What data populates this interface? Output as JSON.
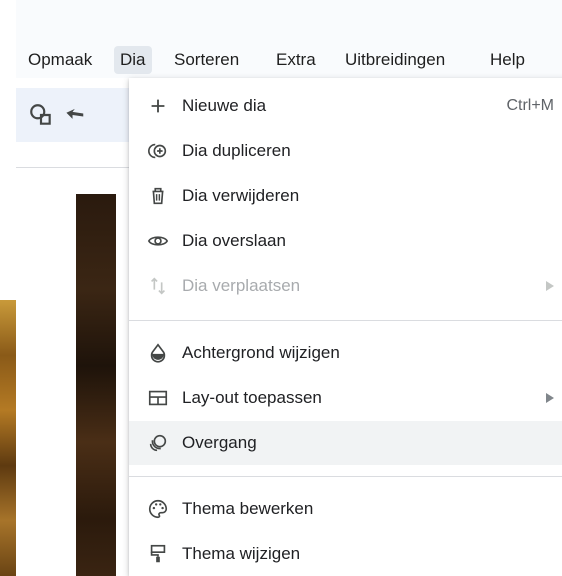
{
  "menubar": {
    "items": [
      {
        "label": "Opmaak"
      },
      {
        "label": "Dia"
      },
      {
        "label": "Sorteren"
      },
      {
        "label": "Extra"
      },
      {
        "label": "Uitbreidingen"
      },
      {
        "label": "Help"
      }
    ],
    "active": "Dia"
  },
  "toolbar": {
    "icons": [
      "shapes-icon",
      "select-arrow-icon"
    ]
  },
  "dia_menu": {
    "items": [
      {
        "label": "Nieuwe dia",
        "icon": "plus-icon",
        "shortcut": "Ctrl+M"
      },
      {
        "label": "Dia dupliceren",
        "icon": "duplicate-icon"
      },
      {
        "label": "Dia verwijderen",
        "icon": "trash-icon"
      },
      {
        "label": "Dia overslaan",
        "icon": "eye-icon"
      },
      {
        "label": "Dia verplaatsen",
        "icon": "move-icon",
        "disabled": true,
        "submenu": true
      },
      {
        "label": "Achtergrond wijzigen",
        "icon": "fill-drop-icon"
      },
      {
        "label": "Lay-out toepassen",
        "icon": "layout-icon",
        "submenu": true
      },
      {
        "label": "Overgang",
        "icon": "transition-icon",
        "hovered": true
      },
      {
        "label": "Thema bewerken",
        "icon": "palette-icon"
      },
      {
        "label": "Thema wijzigen",
        "icon": "paint-roller-icon"
      }
    ]
  },
  "colors": {
    "menubar_bg": "#f9fbfd",
    "toolbar_bg": "#edf2fa",
    "active_menu_bg": "#e3e8ee",
    "hover_bg": "#f1f3f4",
    "text": "#202124",
    "disabled_text": "#a8abae"
  }
}
